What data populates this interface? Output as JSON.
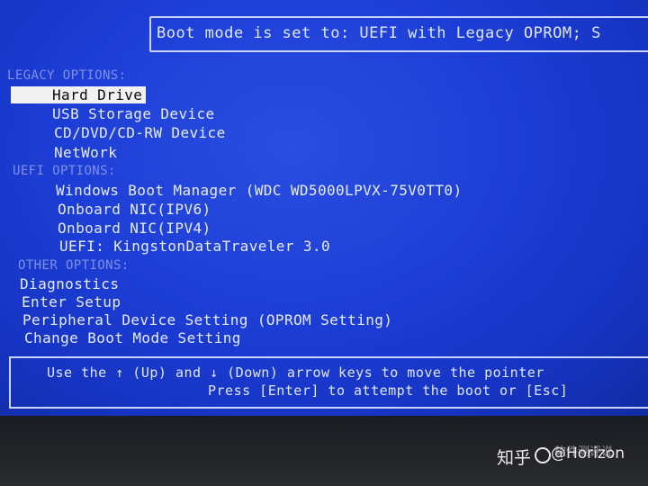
{
  "header": {
    "boot_mode_text": "Boot mode is set to: UEFI with Legacy OPROM; S"
  },
  "legacy": {
    "title": "LEGACY OPTIONS:",
    "items": [
      "Hard Drive",
      "USB Storage Device",
      "CD/DVD/CD-RW Device",
      "NetWork"
    ]
  },
  "uefi": {
    "title": "UEFI OPTIONS:",
    "items": [
      "Windows Boot Manager (WDC WD5000LPVX-75V0TT0)",
      "Onboard NIC(IPV6)",
      "Onboard NIC(IPV4)",
      "UEFI: KingstonDataTraveler 3.0"
    ]
  },
  "other": {
    "title": "OTHER OPTIONS:",
    "items": [
      "Diagnostics",
      "Enter Setup",
      "Peripheral Device Setting (OPROM Setting)",
      "Change Boot Mode Setting"
    ]
  },
  "footer": {
    "line1": "Use the ↑ (Up) and ↓ (Down) arrow keys to move the pointer",
    "line2": "Press [Enter] to attempt the boot or [Esc]"
  },
  "watermark": {
    "zhihu": "知乎",
    "author": "@Horizon",
    "overlay": "软件测评说"
  },
  "colors": {
    "screen": "#1d3ed6",
    "selected_bg": "#f1f1f1",
    "text": "#e6ebff",
    "section": "#7f90e6"
  }
}
